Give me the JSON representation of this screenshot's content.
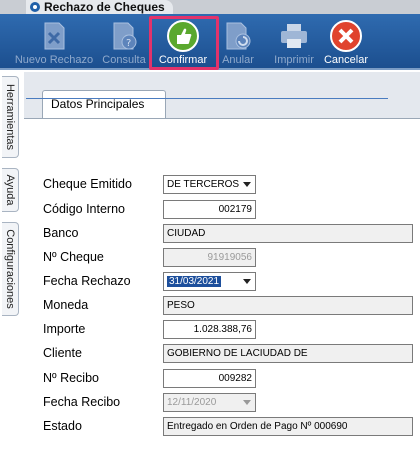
{
  "window": {
    "title": "Rechazo de Cheques"
  },
  "toolbar": {
    "nuevo": "Nuevo Rechazo",
    "consulta": "Consulta",
    "confirmar": "Confirmar",
    "anular": "Anular",
    "imprimir": "Imprimir",
    "cancelar": "Cancelar"
  },
  "side_tabs": {
    "herramientas": "Herramientas",
    "ayuda": "Ayuda",
    "configuraciones": "Configuraciones"
  },
  "main_tab": "Datos Principales",
  "form": {
    "cheque_emitido": {
      "label": "Cheque Emitido",
      "value": "DE TERCEROS"
    },
    "codigo_interno": {
      "label": "Código Interno",
      "value": "002179"
    },
    "banco": {
      "label": "Banco",
      "value": "CIUDAD"
    },
    "nro_cheque": {
      "label": "Nº Cheque",
      "value": "91919056"
    },
    "fecha_rechazo": {
      "label": "Fecha Rechazo",
      "value": "31/03/2021"
    },
    "moneda": {
      "label": "Moneda",
      "value": "PESO"
    },
    "importe": {
      "label": "Importe",
      "value": "1.028.388,76"
    },
    "cliente": {
      "label": "Cliente",
      "value": "GOBIERNO DE LACIUDAD DE"
    },
    "nro_recibo": {
      "label": "Nº Recibo",
      "value": "009282"
    },
    "fecha_recibo": {
      "label": "Fecha Recibo",
      "value": "12/11/2020"
    },
    "estado": {
      "label": "Estado",
      "value": "Entregado en Orden de Pago Nº 000690"
    }
  },
  "colors": {
    "toolbar": "#2f6bb0",
    "highlight": "#e2336b",
    "confirm_green": "#5aa82e",
    "cancel_red": "#e0432d"
  }
}
